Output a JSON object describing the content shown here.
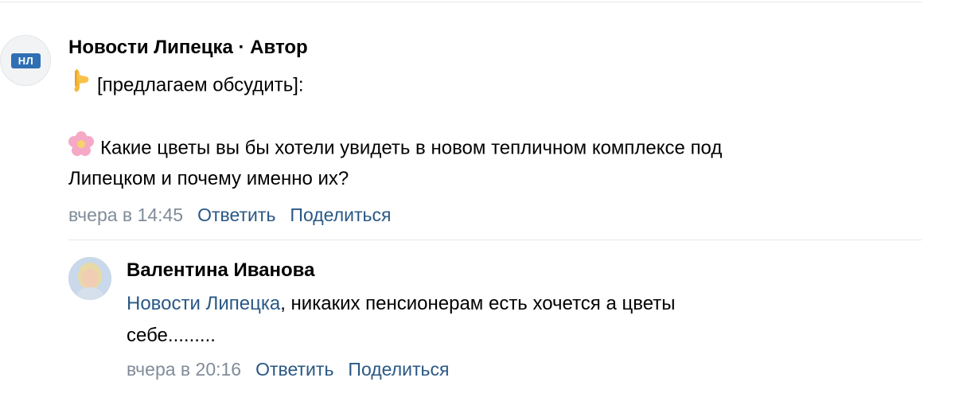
{
  "post": {
    "author": "Новости Липецка · Автор",
    "avatar_text": "НЛ",
    "intro_icon": "pointing-down-finger-icon",
    "intro_text": "[предлагаем обсудить]:",
    "question_icon": "blossom-flower-icon",
    "question_line1": "Какие цветы вы бы хотели увидеть в новом тепличном комплексе под",
    "question_line2": "Липецком и почему именно их?",
    "time": "вчера в 14:45",
    "reply_label": "Ответить",
    "share_label": "Поделиться"
  },
  "reply": {
    "author": "Валентина Иванова",
    "mention": "Новости Липецка",
    "text_line1": ", никаких пенсионерам есть хочется а цветы",
    "text_line2": "себе.........",
    "time": "вчера в 20:16",
    "reply_label": "Ответить",
    "share_label": "Поделиться"
  },
  "colors": {
    "link": "#2a5885",
    "meta": "#818c99",
    "divider": "#e7e8ec",
    "badge": "#2f6fb3"
  }
}
